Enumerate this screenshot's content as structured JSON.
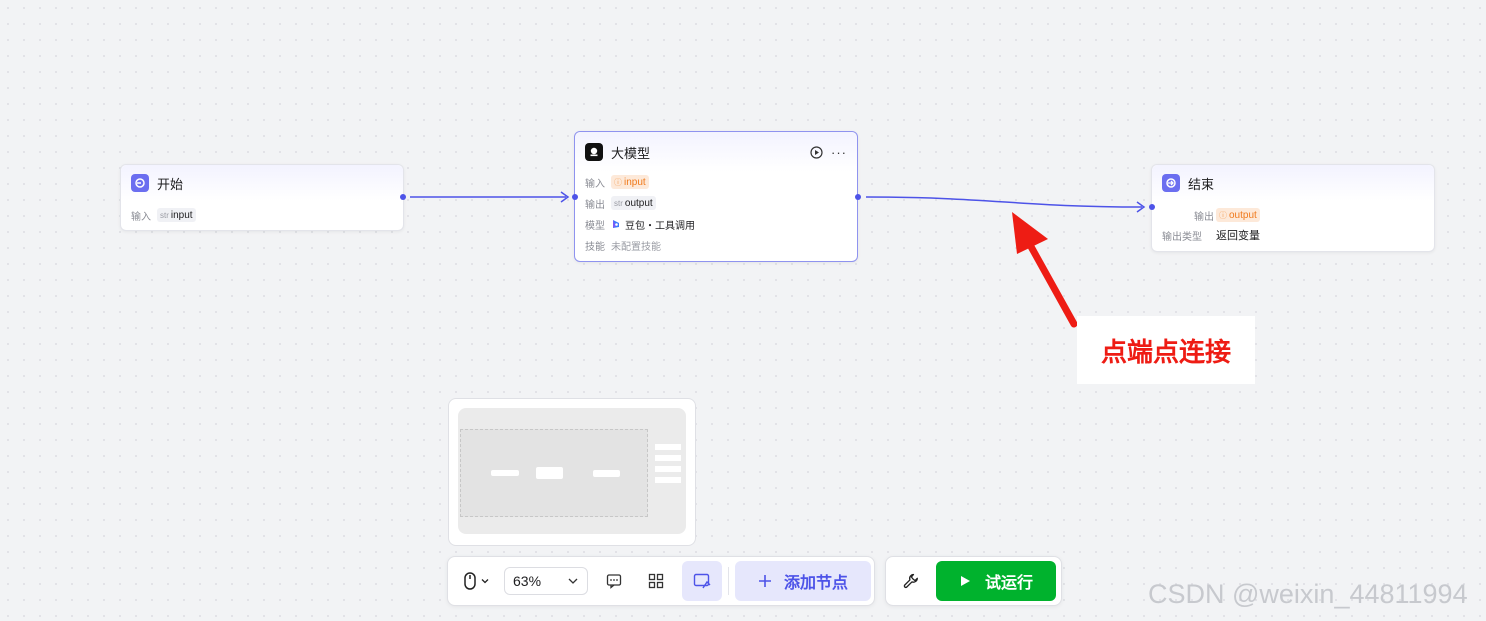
{
  "nodes": {
    "start": {
      "title": "开始",
      "input_label": "输入",
      "input_type": "str",
      "input_value": "input"
    },
    "llm": {
      "title": "大模型",
      "input_label": "输入",
      "input_value": "input",
      "output_label": "输出",
      "output_type": "str",
      "output_value": "output",
      "model_label": "模型",
      "model_value": "豆包・工具调用",
      "skill_label": "技能",
      "skill_value": "未配置技能"
    },
    "end": {
      "title": "结束",
      "output_label": "输出",
      "output_value": "output",
      "output_type_label": "输出类型",
      "output_type_value": "返回变量"
    }
  },
  "annotation": {
    "text": "点端点连接"
  },
  "toolbar": {
    "zoom": "63%",
    "add_node_label": "添加节点",
    "run_label": "试运行"
  },
  "watermark": "CSDN @weixin_44811994",
  "colors": {
    "accent": "#4d53e8",
    "run_green": "#00b22d",
    "annotation_red": "#ee1c14",
    "variable_orange": "#f07a1c"
  }
}
